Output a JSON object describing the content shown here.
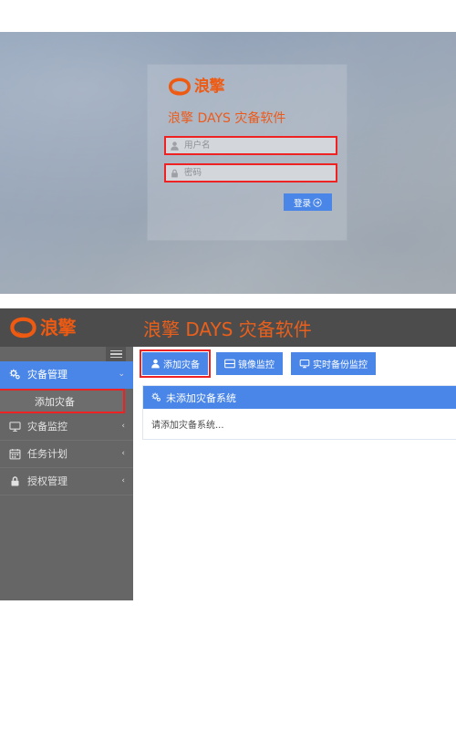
{
  "login": {
    "brand": {
      "logo_icon": "langqing-swirl-logo",
      "word": "浪擎"
    },
    "title": "浪擎 DAYS 灾备软件",
    "username": {
      "icon": "user-icon",
      "placeholder": "用户名",
      "value": ""
    },
    "password": {
      "icon": "lock-icon",
      "placeholder": "密码",
      "value": ""
    },
    "submit_label": "登录",
    "submit_icon": "arrow-circle-right-icon"
  },
  "app": {
    "brand": {
      "logo_icon": "langqing-swirl-logo",
      "word": "浪擎"
    },
    "title": "浪擎 DAYS 灾备软件",
    "hamburger_icon": "hamburger-menu-icon",
    "sidebar": {
      "items": [
        {
          "label": "灾备管理",
          "icon": "gears-icon",
          "caret": "⌄",
          "active": true
        },
        {
          "label": "灾备监控",
          "icon": "monitor-icon",
          "caret": "‹",
          "active": false
        },
        {
          "label": "任务计划",
          "icon": "calendar-icon",
          "caret": "‹",
          "active": false
        },
        {
          "label": "授权管理",
          "icon": "lock-icon",
          "caret": "‹",
          "active": false
        }
      ],
      "submenu": {
        "label": "添加灾备",
        "highlighted": true
      }
    },
    "toolbar": {
      "buttons": [
        {
          "label": "添加灾备",
          "icon": "user-icon",
          "highlighted": true
        },
        {
          "label": "镜像监控",
          "icon": "card-icon",
          "highlighted": false
        },
        {
          "label": "实时备份监控",
          "icon": "desktop-monitor-icon",
          "highlighted": false
        }
      ]
    },
    "panel": {
      "header_icon": "gears-icon",
      "header_title": "未添加灾备系统",
      "body_text": "请添加灾备系统..."
    }
  },
  "colors": {
    "brand_orange": "#ee5a12",
    "accent_blue": "#4a86e8",
    "highlight_red": "#ee2222",
    "header_dark": "#4c4c4c",
    "sidebar_gray": "#666666"
  }
}
